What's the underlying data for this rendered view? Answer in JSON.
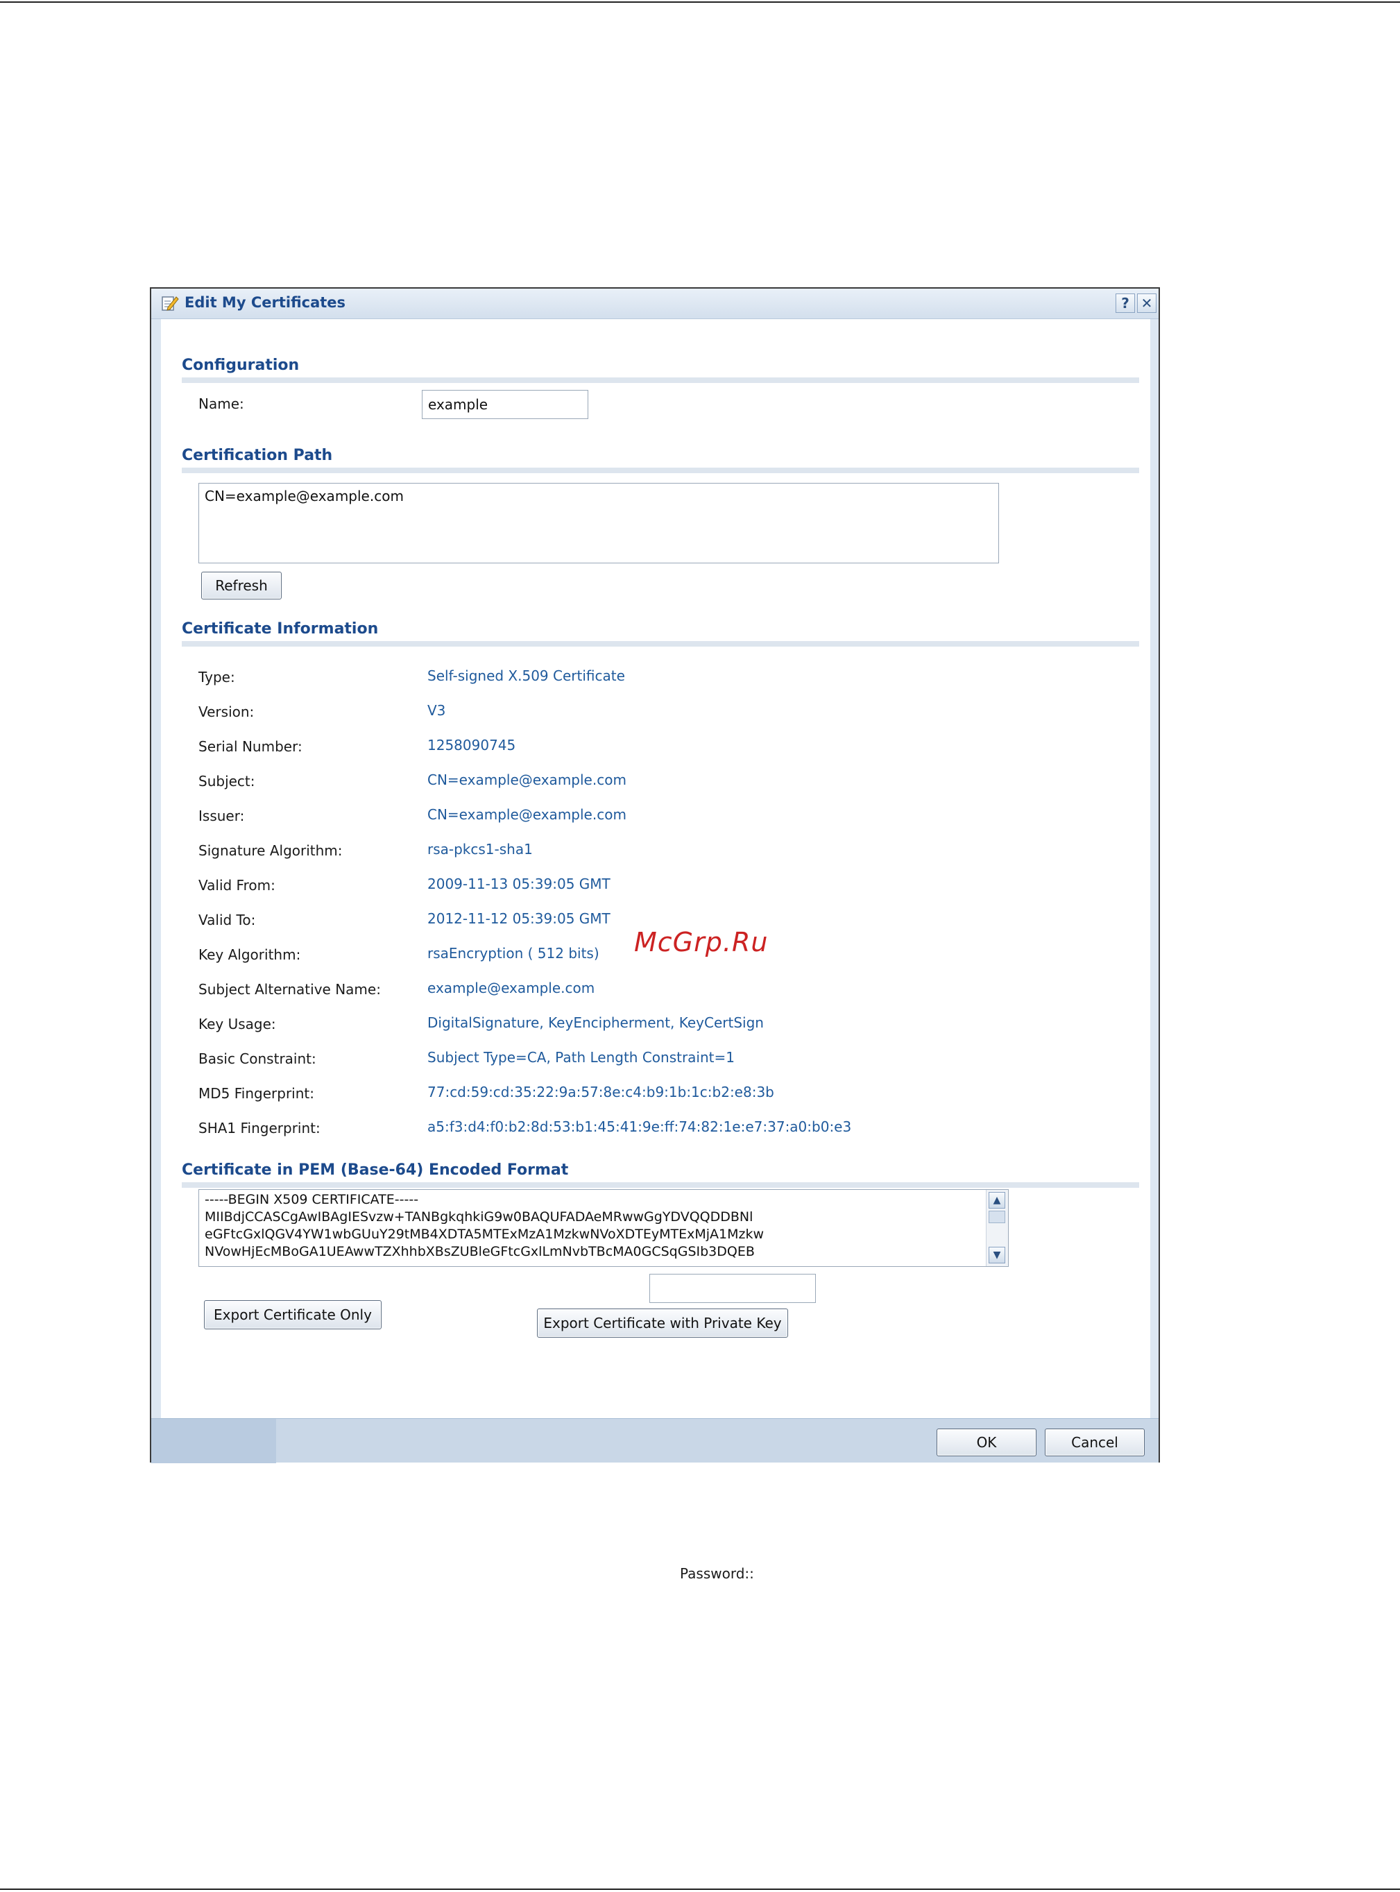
{
  "dialog": {
    "title": "Edit My Certificates",
    "help_label": "?",
    "close_label": "✕"
  },
  "configuration": {
    "heading": "Configuration",
    "name_label": "Name:",
    "name_value": "example"
  },
  "cert_path": {
    "heading": "Certification Path",
    "path_text": "CN=example@example.com",
    "refresh_label": "Refresh"
  },
  "cert_info": {
    "heading": "Certificate Information",
    "rows": [
      {
        "label": "Type:",
        "value": "Self-signed X.509 Certificate"
      },
      {
        "label": "Version:",
        "value": "V3"
      },
      {
        "label": "Serial Number:",
        "value": "1258090745"
      },
      {
        "label": "Subject:",
        "value": "CN=example@example.com"
      },
      {
        "label": "Issuer:",
        "value": "CN=example@example.com"
      },
      {
        "label": "Signature Algorithm:",
        "value": "rsa-pkcs1-sha1"
      },
      {
        "label": "Valid From:",
        "value": "2009-11-13 05:39:05 GMT"
      },
      {
        "label": "Valid To:",
        "value": "2012-11-12 05:39:05 GMT"
      },
      {
        "label": "Key Algorithm:",
        "value": "rsaEncryption ( 512 bits)"
      },
      {
        "label": "Subject Alternative Name:",
        "value": "example@example.com"
      },
      {
        "label": "Key Usage:",
        "value": "DigitalSignature, KeyEncipherment, KeyCertSign"
      },
      {
        "label": "Basic Constraint:",
        "value": "Subject Type=CA, Path Length Constraint=1"
      },
      {
        "label": "MD5 Fingerprint:",
        "value": "77:cd:59:cd:35:22:9a:57:8e:c4:b9:1b:1c:b2:e8:3b"
      },
      {
        "label": "SHA1 Fingerprint:",
        "value": "a5:f3:d4:f0:b2:8d:53:b1:45:41:9e:ff:74:82:1e:e7:37:a0:b0:e3"
      }
    ]
  },
  "pem": {
    "heading": "Certificate in PEM (Base-64) Encoded Format",
    "lines": [
      "-----BEGIN X509 CERTIFICATE-----",
      "MIIBdjCCASCgAwIBAgIESvzw+TANBgkqhkiG9w0BAQUFADAeMRwwGgYDVQQDDBNl",
      "eGFtcGxlQGV4YW1wbGUuY29tMB4XDTA5MTExMzA1MzkwNVoXDTEyMTExMjA1Mzkw",
      "NVowHjEcMBoGA1UEAwwTZXhhbXBsZUBleGFtcGxlLmNvbTBcMA0GCSqGSIb3DQEB"
    ],
    "password_label": "Password::",
    "password_value": "",
    "export_cert_only_label": "Export Certificate Only",
    "export_with_key_label": "Export Certificate with Private Key"
  },
  "footer": {
    "ok_label": "OK",
    "cancel_label": "Cancel"
  },
  "watermark": "McGrp.Ru"
}
